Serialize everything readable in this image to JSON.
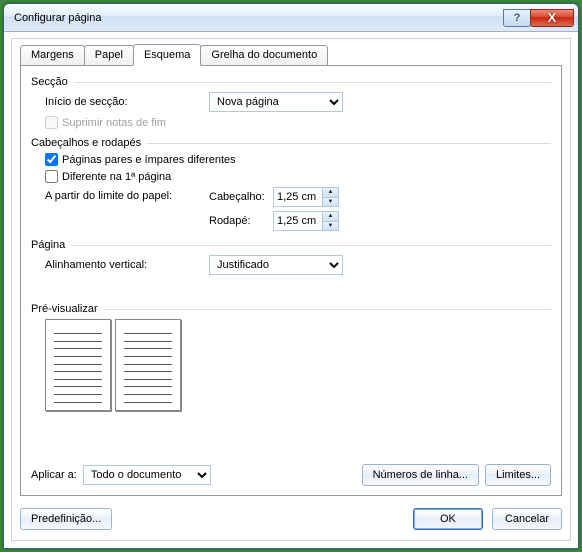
{
  "window": {
    "title": "Configurar página"
  },
  "tabs": {
    "margens": "Margens",
    "papel": "Papel",
    "esquema": "Esquema",
    "grelha": "Grelha do documento"
  },
  "section": {
    "group": "Secção",
    "start_label": "Início de secção:",
    "start_value": "Nova página",
    "suppress_endnotes": "Suprimir notas de fim"
  },
  "headers": {
    "group": "Cabeçalhos e rodapés",
    "odd_even": "Páginas pares e ímpares diferentes",
    "first_page": "Diferente na 1ª página",
    "from_edge": "A partir do limite do papel:",
    "header_label": "Cabeçalho:",
    "footer_label": "Rodapé:",
    "header_value": "1,25 cm",
    "footer_value": "1,25 cm"
  },
  "page": {
    "group": "Página",
    "valign_label": "Alinhamento vertical:",
    "valign_value": "Justificado"
  },
  "preview": {
    "group": "Pré-visualizar"
  },
  "apply": {
    "label": "Aplicar a:",
    "value": "Todo o documento"
  },
  "buttons": {
    "line_numbers": "Números de linha...",
    "borders": "Limites...",
    "default": "Predefinição...",
    "ok": "OK",
    "cancel": "Cancelar"
  }
}
